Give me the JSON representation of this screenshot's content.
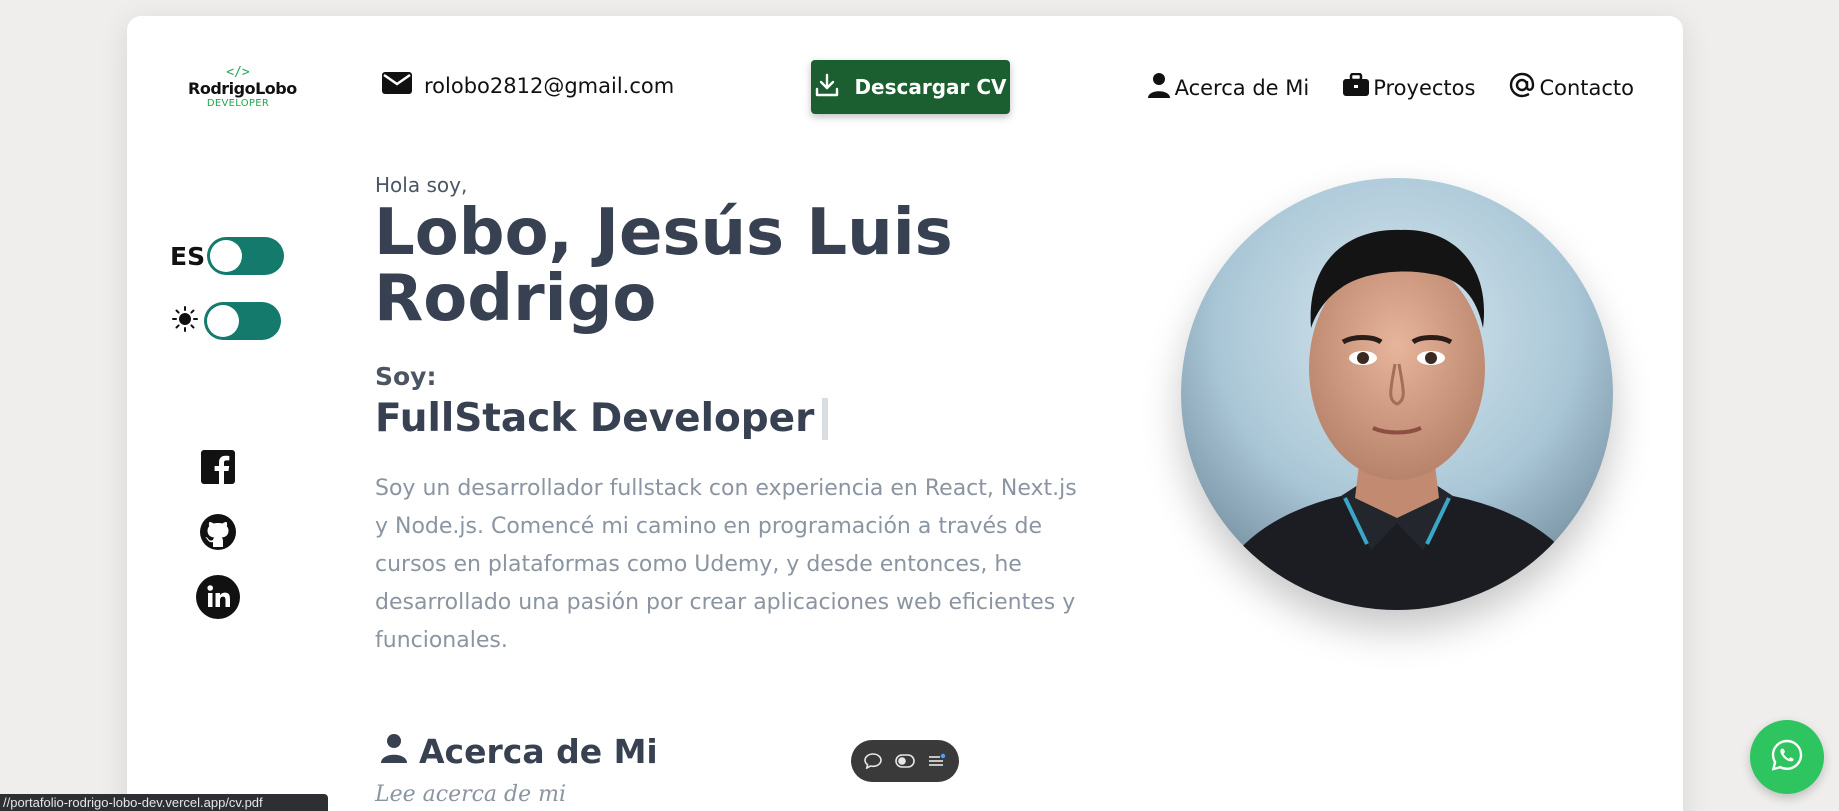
{
  "header": {
    "logo": {
      "mark": "</>",
      "name": "RodrigoLobo",
      "sub": "DEVELOPER"
    },
    "email": "rolobo2812@gmail.com",
    "cv_button": "Descargar CV",
    "nav": [
      {
        "label": "Acerca de Mi",
        "icon": "user-icon"
      },
      {
        "label": "Proyectos",
        "icon": "briefcase-icon"
      },
      {
        "label": "Contacto",
        "icon": "at-icon"
      }
    ]
  },
  "controls": {
    "language_label": "ES",
    "language_toggle_on": false,
    "theme_icon": "sun-icon",
    "theme_toggle_on": false
  },
  "social": [
    {
      "name": "facebook-icon"
    },
    {
      "name": "github-icon"
    },
    {
      "name": "linkedin-icon"
    }
  ],
  "hero": {
    "greeting": "Hola soy,",
    "name_line1": "Lobo, Jesús Luis",
    "name_line2": "Rodrigo",
    "soy_label": "Soy:",
    "role": "FullStack Developer",
    "bio": "Soy un desarrollador fullstack con experiencia en React, Next.js y Node.js. Comencé mi camino en programación a través de cursos en plataformas como Udemy, y desde entonces, he desarrollado una pasión por crear aplicaciones web eficientes y funcionales."
  },
  "section": {
    "title": "Acerca de Mi",
    "subtitle": "Lee acerca de mi"
  },
  "status_url": "//portafolio-rodrigo-lobo-dev.vercel.app/cv.pdf",
  "colors": {
    "accent_green": "#1b5e2f",
    "toggle_teal": "#137a6c",
    "whatsapp_green": "#2ec45f",
    "heading": "#374151",
    "muted_text": "#8b95a1"
  }
}
